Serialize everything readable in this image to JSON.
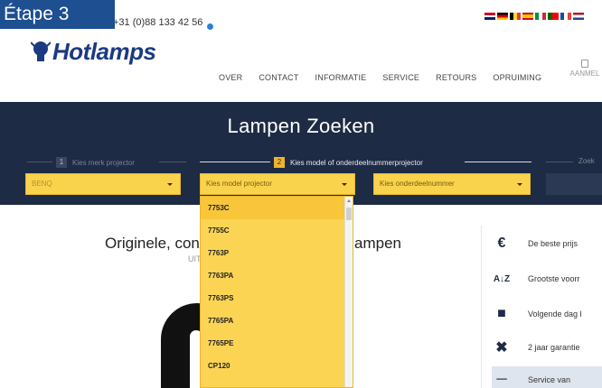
{
  "step_badge": "Étape 3",
  "topbar": {
    "phone": "+31 (0)88 133 42 56"
  },
  "header": {
    "logo": "Hotlamps",
    "nav": [
      "OVER",
      "CONTACT",
      "INFORMATIE",
      "SERVICE",
      "RETOURS",
      "OPRUIMING"
    ],
    "account_label": "AANMEL"
  },
  "search": {
    "title": "Lampen Zoeken",
    "step1": {
      "num": "1",
      "label": "Kies merk projector",
      "value": "BENQ"
    },
    "step2": {
      "num": "2",
      "label": "Kies model of onderdeelnummerprojector"
    },
    "step3_label": "Zoek",
    "model_select": "Kies model projector",
    "part_select": "Kies onderdeelnummer"
  },
  "dropdown": {
    "items": [
      "7753C",
      "7755C",
      "7763P",
      "7763PA",
      "7763PS",
      "7765PA",
      "7765PE",
      "CP120"
    ]
  },
  "main": {
    "headline": "Originele, con",
    "headline_tail": "ampen",
    "subline": "UIT"
  },
  "features": [
    {
      "icon": "euro-icon",
      "glyph": "€",
      "label": "De beste prijs"
    },
    {
      "icon": "sort-az-icon",
      "glyph": "A↓Z",
      "label": "Grootste voorr"
    },
    {
      "icon": "truck-icon",
      "glyph": "■",
      "label": "Volgende dag l"
    },
    {
      "icon": "tools-icon",
      "glyph": "✖",
      "label": "2 jaar garantie"
    },
    {
      "icon": "service-icon",
      "glyph": "─",
      "label": "Service van"
    }
  ],
  "colors": {
    "brand": "#1b3a82",
    "band": "#1d2b44",
    "select": "#f9d34c",
    "badge": "#1d4f91"
  }
}
